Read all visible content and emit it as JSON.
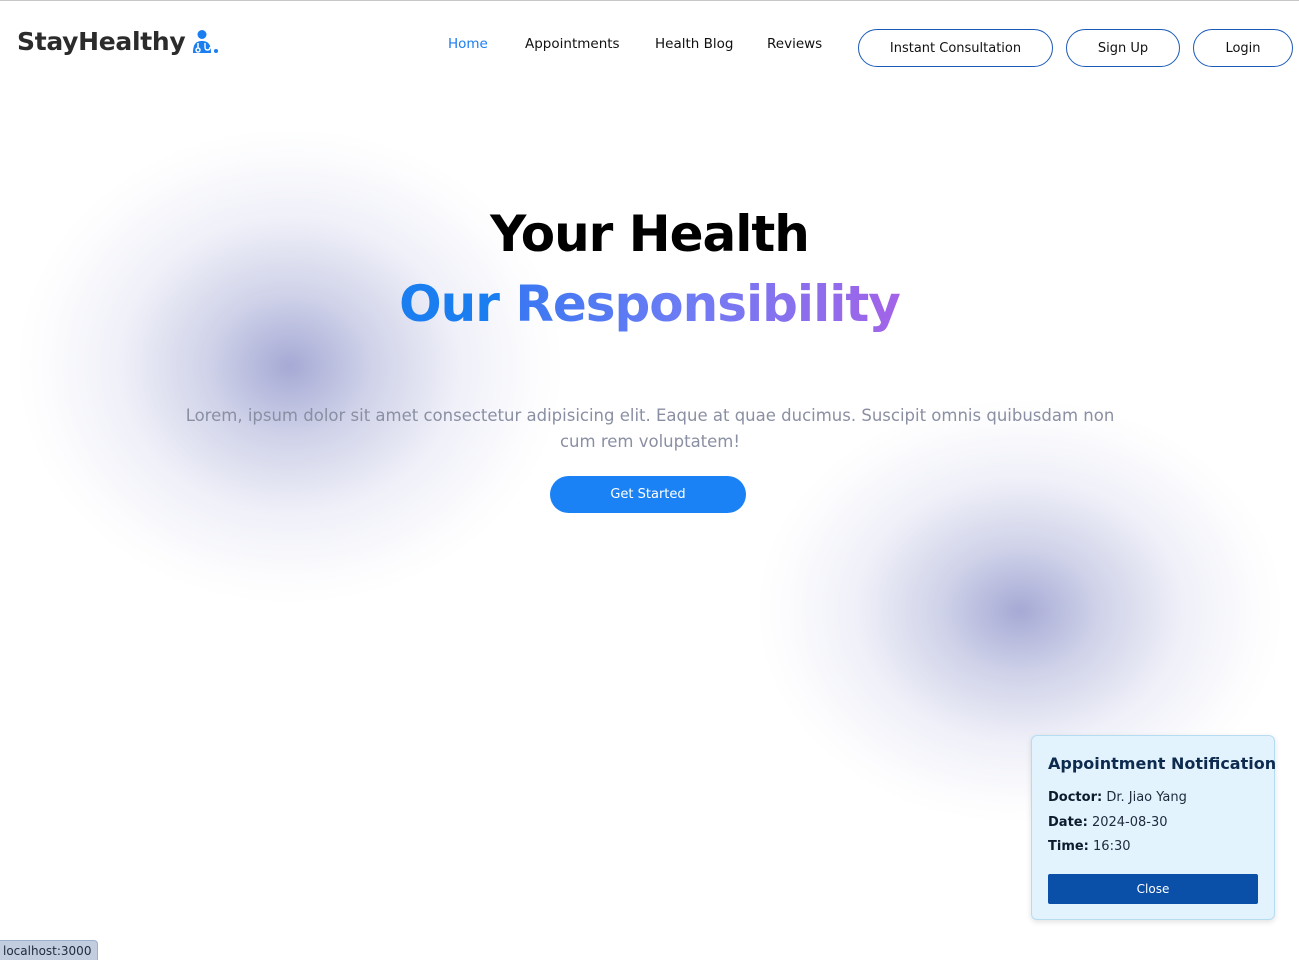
{
  "brand": {
    "name": "StayHealthy",
    "icon": "doctor-icon",
    "accent_color": "#1b7ef0"
  },
  "nav": {
    "links": [
      {
        "label": "Home",
        "active": true
      },
      {
        "label": "Appointments",
        "active": false
      },
      {
        "label": "Health Blog",
        "active": false
      },
      {
        "label": "Reviews",
        "active": false
      }
    ],
    "buttons": [
      {
        "label": "Instant Consultation"
      },
      {
        "label": "Sign Up"
      },
      {
        "label": "Login"
      }
    ]
  },
  "hero": {
    "title_line1": "Your Health",
    "title_line2_word1": "Our",
    "title_line2_word2": "Responsibility",
    "description": "Lorem, ipsum dolor sit amet consectetur adipisicing elit. Eaque at quae ducimus. Suscipit omnis quibusdam non cum rem voluptatem!",
    "cta_label": "Get Started"
  },
  "notification": {
    "title": "Appointment Notification",
    "doctor_label": "Doctor:",
    "doctor_value": "Dr. Jiao Yang",
    "date_label": "Date:",
    "date_value": "2024-08-30",
    "time_label": "Time:",
    "time_value": "16:30",
    "close_label": "Close"
  },
  "status_bar": {
    "url": "localhost:3000"
  }
}
